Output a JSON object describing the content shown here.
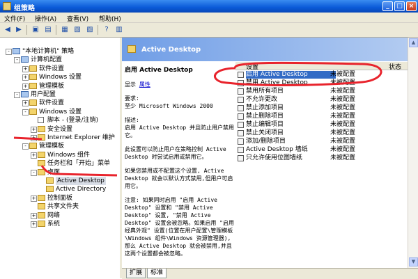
{
  "window": {
    "title": "组策略"
  },
  "menu": [
    "文件(F)",
    "操作(A)",
    "查看(V)",
    "帮助(H)"
  ],
  "tree": [
    {
      "label": "\"本地计算机\" 策略",
      "level": 0,
      "expander": "-",
      "icon": "pc"
    },
    {
      "label": "计算机配置",
      "level": 1,
      "expander": "-",
      "icon": "pc"
    },
    {
      "label": "软件设置",
      "level": 2,
      "expander": "+",
      "icon": "folder"
    },
    {
      "label": "Windows 设置",
      "level": 2,
      "expander": "+",
      "icon": "folder"
    },
    {
      "label": "管理模板",
      "level": 2,
      "expander": "+",
      "icon": "folder"
    },
    {
      "label": "用户配置",
      "level": 1,
      "expander": "-",
      "icon": "pc"
    },
    {
      "label": "软件设置",
      "level": 2,
      "expander": "+",
      "icon": "folder"
    },
    {
      "label": "Windows 设置",
      "level": 2,
      "expander": "-",
      "icon": "folder"
    },
    {
      "label": "脚本 - (登录/注销)",
      "level": 3,
      "expander": "",
      "icon": "doc"
    },
    {
      "label": "安全设置",
      "level": 3,
      "expander": "+",
      "icon": "folder"
    },
    {
      "label": "Internet Explorer 维护",
      "level": 3,
      "expander": "+",
      "icon": "folder"
    },
    {
      "label": "管理模板",
      "level": 2,
      "expander": "-",
      "icon": "folder"
    },
    {
      "label": "Windows 组件",
      "level": 3,
      "expander": "+",
      "icon": "folder"
    },
    {
      "label": "任务栏和「开始」菜单",
      "level": 3,
      "expander": "",
      "icon": "folder"
    },
    {
      "label": "桌面",
      "level": 3,
      "expander": "-",
      "icon": "folder"
    },
    {
      "label": "Active Desktop",
      "level": 4,
      "expander": "",
      "icon": "folder",
      "selected": true
    },
    {
      "label": "Active Directory",
      "level": 4,
      "expander": "",
      "icon": "folder"
    },
    {
      "label": "控制面板",
      "level": 3,
      "expander": "+",
      "icon": "folder"
    },
    {
      "label": "共享文件夹",
      "level": 3,
      "expander": "",
      "icon": "folder"
    },
    {
      "label": "网络",
      "level": 3,
      "expander": "+",
      "icon": "folder"
    },
    {
      "label": "系统",
      "level": 3,
      "expander": "+",
      "icon": "folder"
    }
  ],
  "header": {
    "title": "Active Desktop"
  },
  "description": {
    "heading": "启用 Active Desktop",
    "show_label": "显示",
    "properties_link": "属性",
    "requirements_label": "要求:",
    "requirements_value": "至少 Microsoft Windows 2000",
    "desc_label": "描述:",
    "desc_text": "启用 Active Desktop 并且防止用户禁用它。",
    "para2": "此设置可以防止用户在策略控制 Active Desktop 时尝试启用或禁用它。",
    "para3": "如果您禁用或不配置这个设置, Active Desktop 就会以默认方式禁用,但用户可启用它。",
    "para4": "注意: 如果同时启用 \"启用 Active Desktop\" 设置和 \"禁用 Active Desktop\" 设置, \"禁用 Active Desktop\" 设置会被忽略。如果启用 \"启用经典外观\" 设置(位置在用户配置\\管理模板\\Windows 组件\\Windows 资源管理器), 那么 Active Desktop 就会被禁用,并且这两个设置都会被忽略。"
  },
  "list_columns": {
    "setting": "设置",
    "state": "状态"
  },
  "list": [
    {
      "name": "启用 Active Desktop",
      "state": "未被配置",
      "selected": true
    },
    {
      "name": "禁用 Active Desktop",
      "state": "未被配置"
    },
    {
      "name": "禁用所有项目",
      "state": "未被配置"
    },
    {
      "name": "不允许更改",
      "state": "未被配置"
    },
    {
      "name": "禁止添加项目",
      "state": "未被配置"
    },
    {
      "name": "禁止删除项目",
      "state": "未被配置"
    },
    {
      "name": "禁止编辑项目",
      "state": "未被配置"
    },
    {
      "name": "禁止关闭项目",
      "state": "未被配置"
    },
    {
      "name": "添加/删除项目",
      "state": "未被配置"
    },
    {
      "name": "Active Desktop 墙纸",
      "state": "未被配置"
    },
    {
      "name": "只允许使用位图墙纸",
      "state": "未被配置"
    }
  ],
  "tabs": [
    "扩展",
    "标准"
  ]
}
